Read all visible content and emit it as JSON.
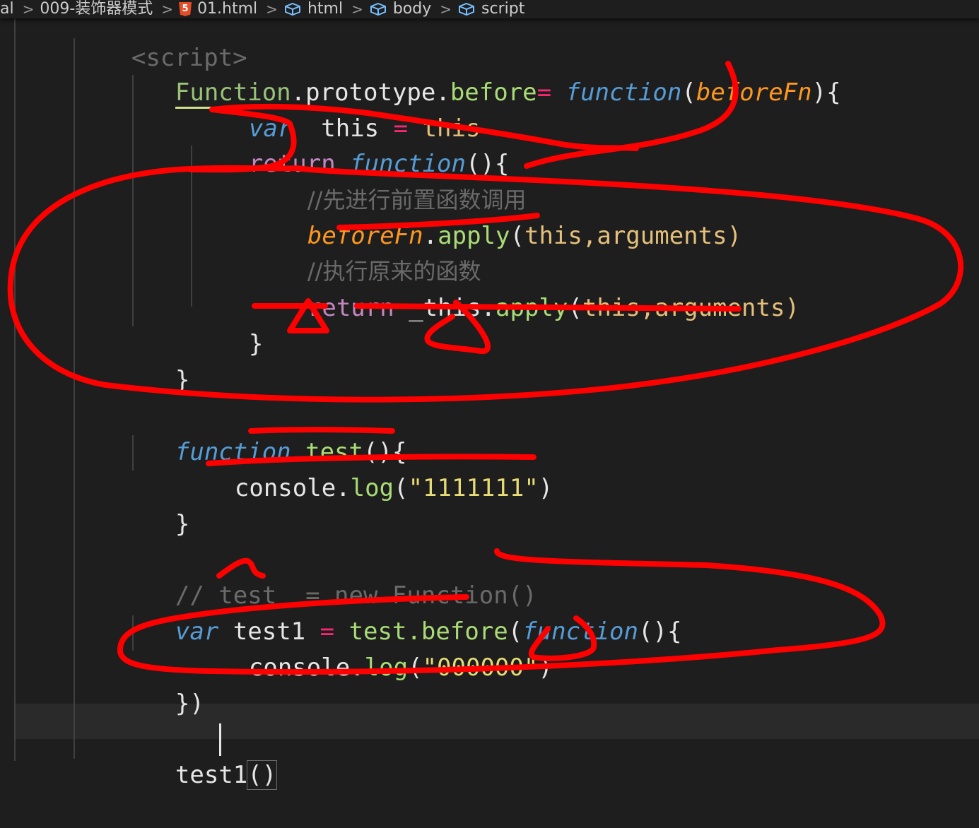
{
  "breadcrumb": {
    "items": [
      {
        "label": "al",
        "icon": ""
      },
      {
        "label": "009-装饰器模式",
        "icon": ""
      },
      {
        "label": "01.html",
        "icon": "html5-icon"
      },
      {
        "label": "html",
        "icon": "cube-icon"
      },
      {
        "label": "body",
        "icon": "cube-icon"
      },
      {
        "label": "script",
        "icon": "cube-icon"
      }
    ]
  },
  "code": {
    "line0": {
      "t1": "<script>"
    },
    "line1": {
      "t1": "Function",
      "t2": ".prototype.",
      "t3": "before",
      "t4": "=",
      "t5": " function",
      "t6": "(",
      "t7": "beforeFn",
      "t8": "){"
    },
    "line2": {
      "t1": "var",
      "t2": "  this ",
      "t3": "=",
      "t4": " this"
    },
    "line3": {
      "t1": "return",
      "t2": " function",
      "t3": "(){"
    },
    "line4": {
      "t1": "//先进行前置函数调用"
    },
    "line5": {
      "t1": "beforeFn",
      "t2": ".",
      "t3": "apply",
      "t4": "(",
      "t5": "this",
      "t6": ",arguments)"
    },
    "line6": {
      "t1": "//执行原来的函数"
    },
    "line7": {
      "t1": "return",
      "t2": " _this.",
      "t3": "apply",
      "t4": "(",
      "t5": "this",
      "t6": ",arguments)"
    },
    "line8": {
      "t1": "}"
    },
    "line9": {
      "t1": "}"
    },
    "line10": {
      "t1": "function",
      "t2": " test",
      "t3": "(){"
    },
    "line11": {
      "t1": "console.",
      "t2": "log",
      "t3": "(",
      "t4": "\"1111111\"",
      "t5": ")"
    },
    "line12": {
      "t1": "}"
    },
    "line13": {
      "t1": "// test  = new Function()"
    },
    "line14": {
      "t1": "var",
      "t2": " test1 ",
      "t3": "=",
      "t4": " test.",
      "t5": "before",
      "t6": "(",
      "t7": "function",
      "t8": "(){"
    },
    "line15": {
      "t1": "console.",
      "t2": "log",
      "t3": "(",
      "t4": "\"000000\"",
      "t5": ")"
    },
    "line16": {
      "t1": "})"
    },
    "line17": {
      "t1": "test1",
      "t2": "()"
    }
  },
  "colors": {
    "background": "#1e1e1e",
    "annotation": "#ff0000",
    "keyword_storage": "#569cd6",
    "keyword_control": "#c586c0",
    "string": "#e6db74",
    "comment": "#6a6a6a"
  }
}
